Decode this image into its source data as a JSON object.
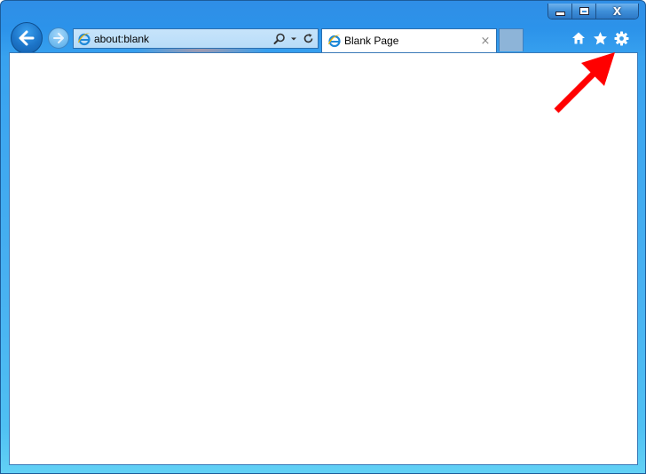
{
  "address_bar": {
    "url": "about:blank",
    "icon": "ie-page-icon"
  },
  "tabs": [
    {
      "title": "Blank Page",
      "icon": "ie-page-icon",
      "close": "×"
    }
  ],
  "caption_buttons": {
    "close_glyph": "X"
  },
  "toolbar_icons": [
    "home-icon",
    "favorites-star-icon",
    "tools-gear-icon"
  ],
  "annotation": {
    "color": "#ff0000",
    "points_to": "tools-gear-icon"
  },
  "colors": {
    "frame_top": "#2f8ee6",
    "frame_bottom": "#62d1f5",
    "address_bg": "#c7e4fb",
    "content_bg": "#ffffff"
  }
}
